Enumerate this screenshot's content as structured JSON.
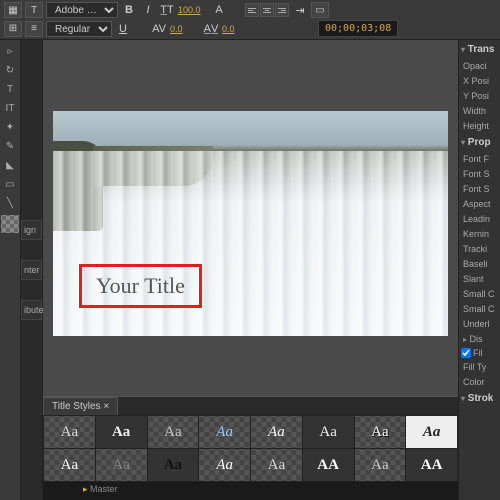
{
  "toolbar": {
    "font_family": "Adobe …",
    "font_weight": "Regular",
    "bold": "B",
    "italic": "I",
    "underline": "U",
    "size": "100.0",
    "kerning": "0.0",
    "tracking": "0.0",
    "aa_label": "A↓",
    "timecode": "00;00;03;08"
  },
  "side_tabs": {
    "align": "ign",
    "center": "nter",
    "distribute": "ibute"
  },
  "canvas": {
    "title_text": "Your Title"
  },
  "styles_panel": {
    "tab_label": "Title Styles",
    "samples": [
      "Aa",
      "Aa",
      "Aa",
      "Aa",
      "Aa",
      "Aa",
      "Aa",
      "Aa",
      "Aa",
      "Aa",
      "Aa",
      "Aa",
      "Aa",
      "AA",
      "Aa",
      "AA"
    ]
  },
  "right_panel": {
    "section_transform": "Trans",
    "opacity": "Opaci",
    "xpos": "X Posi",
    "ypos": "Y Posi",
    "width": "Width",
    "height": "Height",
    "section_properties": "Prop",
    "fontf": "Font F",
    "fonts": "Font S",
    "fontst": "Font S",
    "aspect": "Aspect",
    "leading": "Leadin",
    "kerning": "Kernin",
    "tracking": "Tracki",
    "baseline": "Baseli",
    "slant": "Slant",
    "smallc": "Small C",
    "smalls": "Small C",
    "underl": "Underl",
    "section_dist": "Dis",
    "fill_check": "Fil",
    "filltype": "Fill Ty",
    "color": "Color",
    "stroke": "Strok"
  },
  "timeline": {
    "master": "Master"
  }
}
